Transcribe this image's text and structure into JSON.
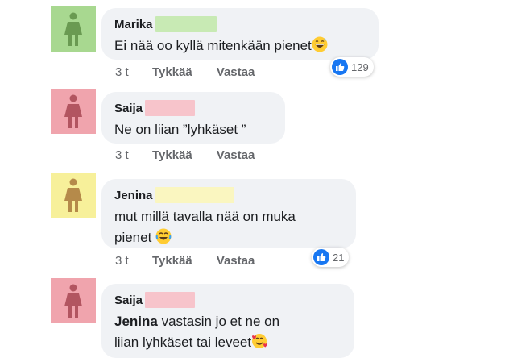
{
  "comments": [
    {
      "author": "Marika",
      "text": "Ei nää oo kyllä mitenkään pienet",
      "emoji": "grinning-sweat-emoji",
      "time": "3 t",
      "like_label": "Tykkää",
      "reply_label": "Vastaa",
      "reaction_count": "129",
      "avatar_color": "#a8d890",
      "censor_color": "#c8eab4"
    },
    {
      "author": "Saija",
      "text": "Ne on liian ”lyhkäset ”",
      "time": "3 t",
      "like_label": "Tykkää",
      "reply_label": "Vastaa",
      "avatar_color": "#f0a4ad",
      "censor_color": "#f7c4cb"
    },
    {
      "author": "Jenina",
      "text_line1": "mut millä tavalla nää on muka",
      "text_line2": "pienet",
      "emoji": "rolling-laughing-emoji",
      "time": "3 t",
      "like_label": "Tykkää",
      "reply_label": "Vastaa",
      "reaction_count": "21",
      "avatar_color": "#f7f09a",
      "censor_color": "#faf6c0"
    },
    {
      "author": "Saija",
      "mention": "Jenina",
      "text_line1": " vastasin jo et ne on",
      "text_line2": "liian lyhkäset tai leveet",
      "emoji": "smiling-hearts-emoji",
      "avatar_color": "#f0a4ad",
      "censor_color": "#f7c4cb"
    }
  ]
}
